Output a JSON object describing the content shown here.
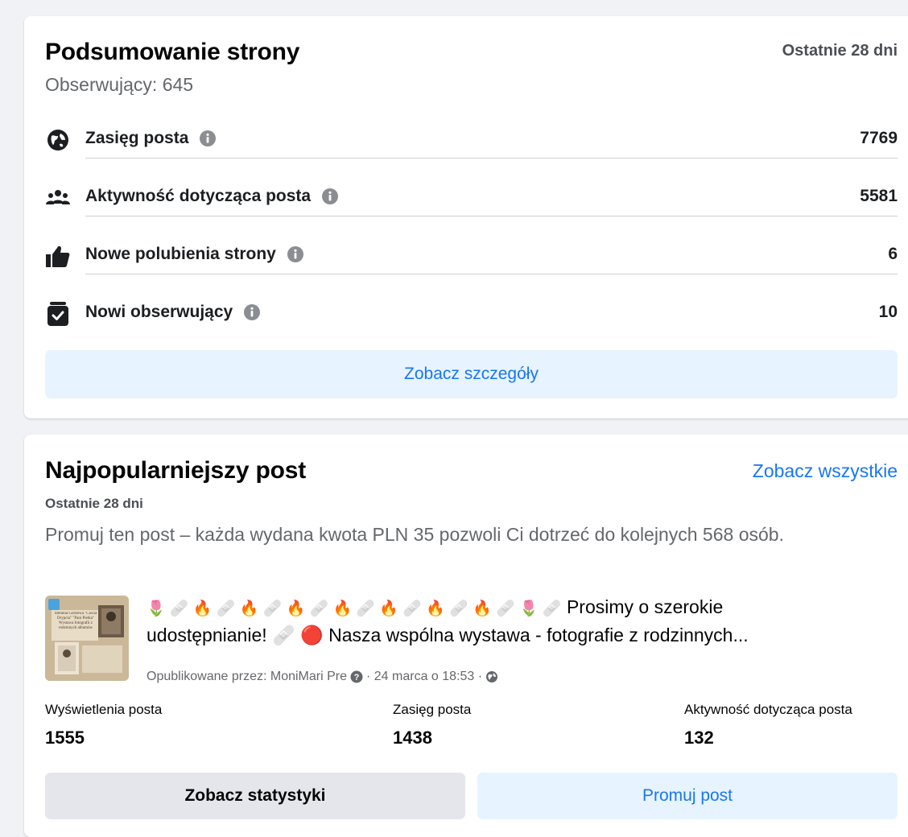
{
  "summary": {
    "title": "Podsumowanie strony",
    "range": "Ostatnie 28 dni",
    "followers": "Obserwujący: 645",
    "metrics": [
      {
        "label": "Zasięg posta",
        "value": "7769",
        "icon": "globe-icon"
      },
      {
        "label": "Aktywność dotycząca posta",
        "value": "5581",
        "icon": "people-icon"
      },
      {
        "label": "Nowe polubienia strony",
        "value": "6",
        "icon": "thumbs-up-icon"
      },
      {
        "label": "Nowi obserwujący",
        "value": "10",
        "icon": "follow-check-icon"
      }
    ],
    "details_button": "Zobacz szczegóły"
  },
  "popular": {
    "title": "Najpopularniejszy post",
    "see_all": "Zobacz wszystkie",
    "range": "Ostatnie 28 dni",
    "promo_text": "Promuj ten post – każda wydana kwota PLN 35 pozwoli Ci dotrzeć do kolejnych 568 osób.",
    "post": {
      "emoji_line": "🌷 🩹 🔥 🩹 🔥 🩹 🔥 🩹 🔥 🩹 🔥 🩹 🔥 🩹 🔥 🩹 🌷 🩹",
      "text_line1": "Prosimy o szerokie",
      "text_line2_a": "udostępnianie! 🩹 🔴",
      "text_line2_b": "Nasza wspólna wystawa - fotografie z rodzinnych...",
      "meta_publisher": "Opublikowane przez: MoniMari Pre",
      "meta_date": "· 24 marca o 18:53 ·",
      "thumbnail_caption": "Stefania Gordowa \"Ciocia Drypcia\" \"Pani Pietka\" Wystawa fotografii z rodzinnych albumów"
    },
    "stats": [
      {
        "label": "Wyświetlenia posta",
        "value": "1555"
      },
      {
        "label": "Zasięg posta",
        "value": "1438"
      },
      {
        "label": "Aktywność dotycząca posta",
        "value": "132"
      }
    ],
    "stats_button": "Zobacz statystyki",
    "promote_button": "Promuj post"
  },
  "colors": {
    "accent": "#1877f2",
    "light_accent_bg": "#e7f3ff",
    "secondary_bg": "#e4e6eb",
    "secondary_text": "#65676b"
  }
}
